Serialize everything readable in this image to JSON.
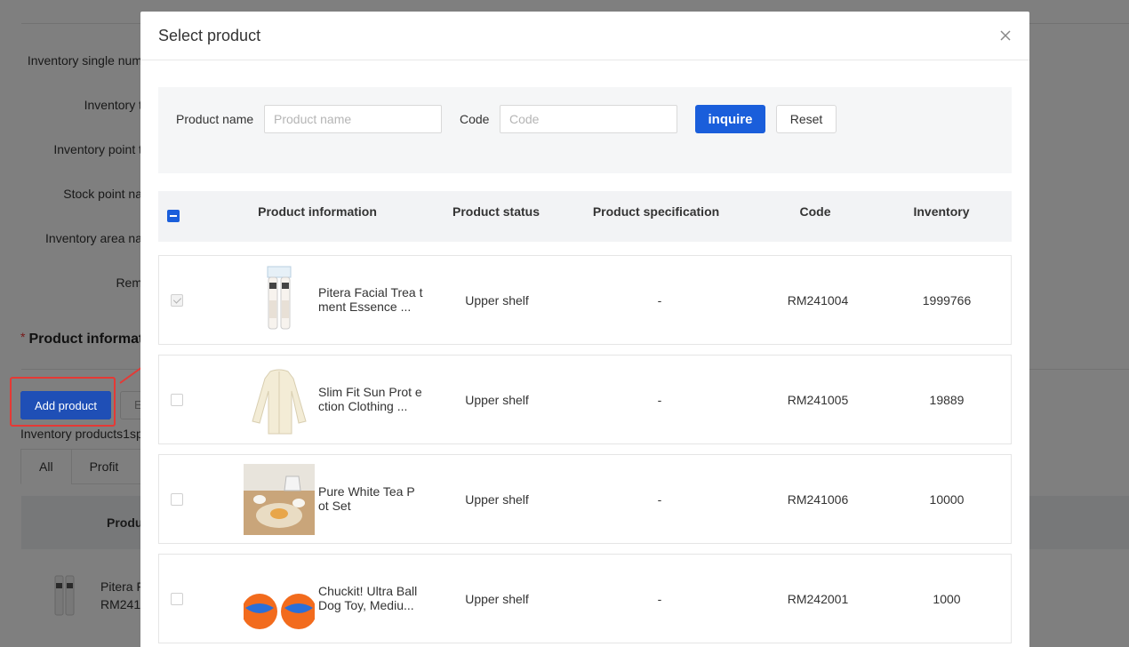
{
  "background": {
    "form_labels": [
      "Inventory single num",
      "Inventory t",
      "Inventory point t",
      "Stock point na",
      "Inventory area na",
      "Rem"
    ],
    "section_title": "Product informat",
    "add_product_label": "Add product",
    "secondary_button_label": "E",
    "summary": "Inventory products1sp",
    "tabs": [
      "All",
      "Profit"
    ],
    "table_header": "Produ",
    "row": {
      "name": "Pitera F",
      "code": "RM241"
    }
  },
  "modal": {
    "title": "Select product",
    "search": {
      "product_name_label": "Product name",
      "product_name_placeholder": "Product name",
      "code_label": "Code",
      "code_placeholder": "Code",
      "inquire_label": "inquire",
      "reset_label": "Reset"
    },
    "columns": [
      "Product information",
      "Product status",
      "Product specification",
      "Code",
      "Inventory"
    ],
    "rows": [
      {
        "name": "Pitera Facial Trea tment Essence ...",
        "status": "Upper shelf",
        "spec": "-",
        "code": "RM241004",
        "inventory": "1999766",
        "checked": true,
        "disabled": true,
        "image": "essence-bottles-image"
      },
      {
        "name": "Slim Fit Sun Prot ection Clothing ...",
        "status": "Upper shelf",
        "spec": "-",
        "code": "RM241005",
        "inventory": "19889",
        "checked": false,
        "disabled": false,
        "image": "sun-clothing-image"
      },
      {
        "name": "Pure White Tea P ot Set",
        "status": "Upper shelf",
        "spec": "-",
        "code": "RM241006",
        "inventory": "10000",
        "checked": false,
        "disabled": false,
        "image": "tea-set-image"
      },
      {
        "name": "Chuckit! Ultra Ball Dog Toy, Mediu...",
        "status": "Upper shelf",
        "spec": "-",
        "code": "RM242001",
        "inventory": "1000",
        "checked": false,
        "disabled": false,
        "image": "dog-ball-image"
      }
    ]
  },
  "colors": {
    "primary": "#1a5edb",
    "highlight": "#e53935"
  }
}
